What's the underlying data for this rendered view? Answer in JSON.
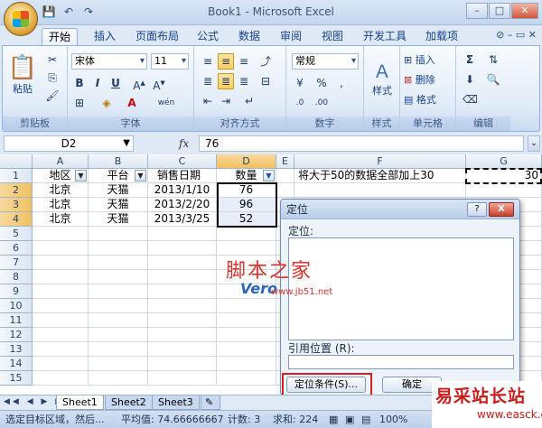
{
  "window": {
    "title": "Book1 - Microsoft Excel"
  },
  "qat": {
    "save": "💾",
    "undo": "↶",
    "redo": "↷"
  },
  "tabs": [
    "开始",
    "插入",
    "页面布局",
    "公式",
    "数据",
    "审阅",
    "视图",
    "开发工具",
    "加载项"
  ],
  "ribbon": {
    "clipboard": {
      "paste": "粘贴",
      "label": "剪贴板"
    },
    "font": {
      "name": "宋体",
      "size": "11",
      "bold": "B",
      "italic": "I",
      "underline": "U",
      "label": "字体",
      "wen": "wén"
    },
    "alignment": {
      "label": "对齐方式"
    },
    "number": {
      "format": "常规",
      "label": "数字",
      "pct": "%",
      "comma": ","
    },
    "styles": {
      "label": "样式",
      "button": "样式"
    },
    "cells": {
      "insert": "插入",
      "delete": "删除",
      "format": "格式",
      "label": "单元格"
    },
    "editing": {
      "label": "编辑",
      "sum": "Σ"
    }
  },
  "formula_bar": {
    "name_box": "D2",
    "fx": "fx",
    "value": "76"
  },
  "columns": [
    "A",
    "B",
    "C",
    "D",
    "E",
    "F",
    "G"
  ],
  "rows": [
    "1",
    "2",
    "3",
    "4",
    "5",
    "6",
    "7",
    "8",
    "9",
    "10",
    "11",
    "12",
    "13",
    "14",
    "15"
  ],
  "sheet": {
    "headers": [
      "地区",
      "平台",
      "销售日期",
      "数量"
    ],
    "data": [
      [
        "北京",
        "天猫",
        "2013/1/10",
        "76"
      ],
      [
        "北京",
        "天猫",
        "2013/2/20",
        "96"
      ],
      [
        "北京",
        "天猫",
        "2013/3/25",
        "52"
      ]
    ],
    "note": "将大于50的数据全部加上30",
    "g1": "30"
  },
  "sheet_tabs": [
    "Sheet1",
    "Sheet2",
    "Sheet3"
  ],
  "status": {
    "mode": "选定目标区域，然后...",
    "average": "平均值: 74.66666667",
    "count": "计数: 3",
    "sum": "求和: 224",
    "zoom": "100%"
  },
  "dialog": {
    "title": "定位",
    "goto_label": "定位:",
    "ref_label": "引用位置 (R):",
    "special_button": "定位条件(S)...",
    "ok_button": "确定",
    "help": "?",
    "close": "X"
  },
  "watermarks": {
    "site1": "脚本之家",
    "site1_logo": "Vero",
    "site1_url": "www.jb51.net",
    "site2": "易采站长站",
    "site2_url": "www.easck.com"
  },
  "colors": {
    "accent": "#15428b",
    "dialog_highlight": "#d81e1e",
    "watermark_red": "#c81c1c"
  }
}
